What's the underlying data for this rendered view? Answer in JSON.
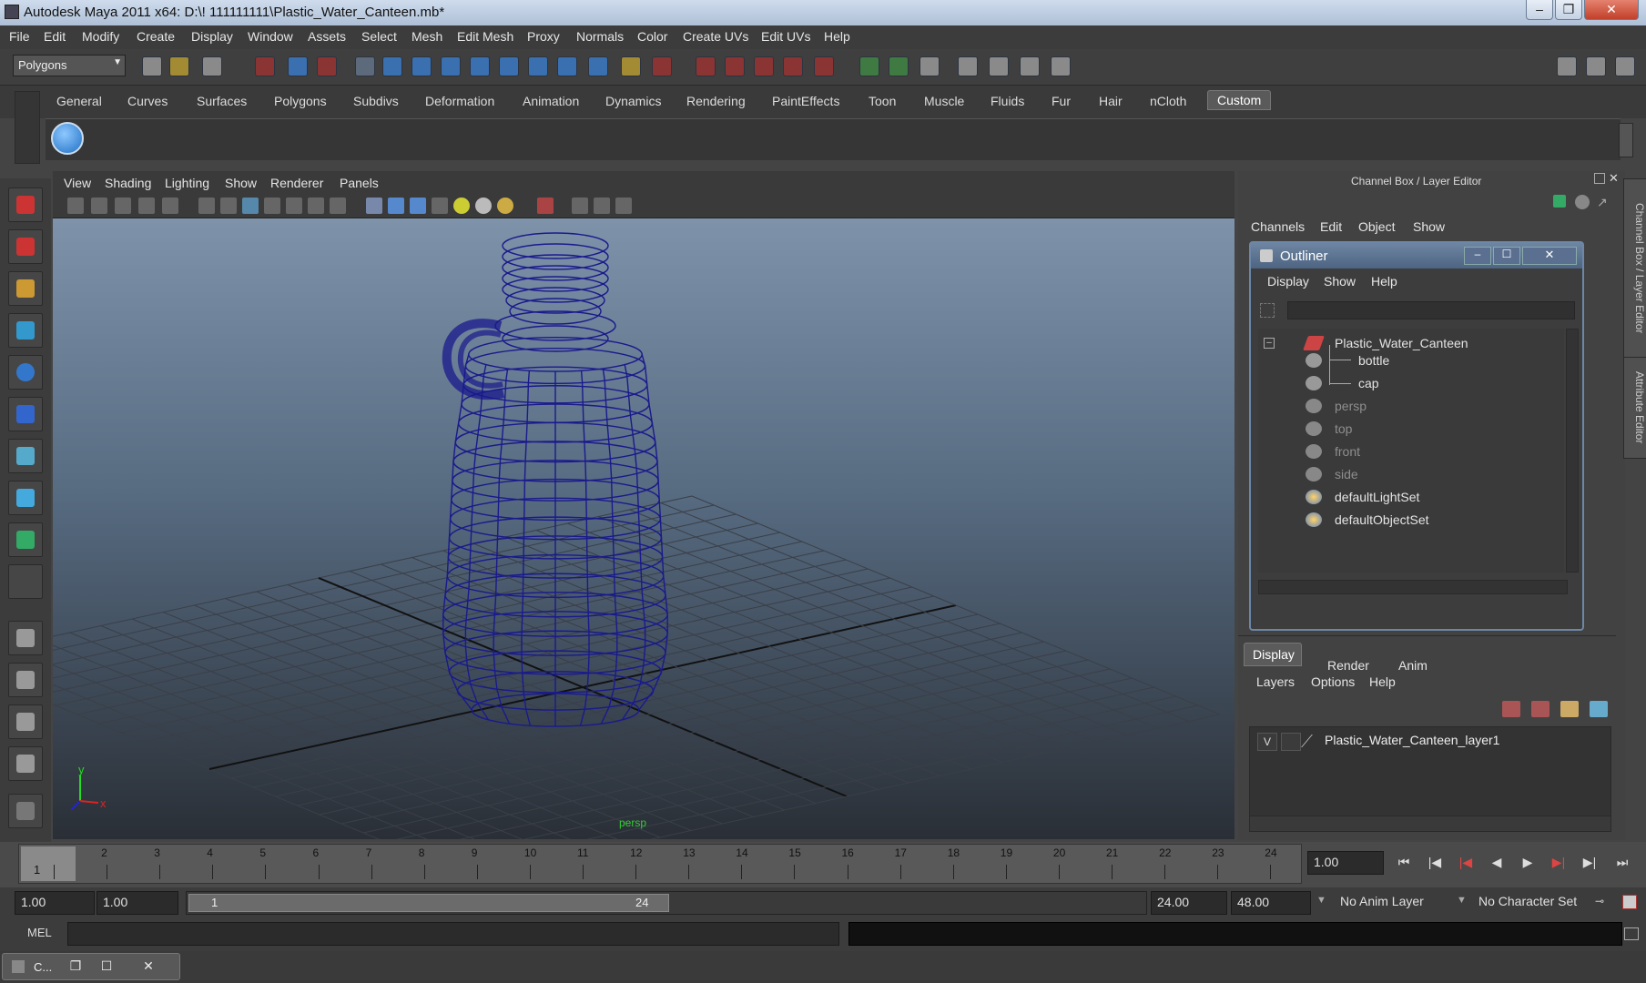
{
  "window": {
    "title": "Autodesk Maya 2011 x64: D:\\! 111111111\\Plastic_Water_Canteen.mb*",
    "controls": [
      "–",
      "❐",
      "✕"
    ]
  },
  "menubar": [
    "File",
    "Edit",
    "Modify",
    "Create",
    "Display",
    "Window",
    "Assets",
    "Select",
    "Mesh",
    "Edit Mesh",
    "Proxy",
    "Normals",
    "Color",
    "Create UVs",
    "Edit UVs",
    "Help"
  ],
  "toolbar": {
    "menuset": "Polygons"
  },
  "shelf": {
    "tabs": [
      "General",
      "Curves",
      "Surfaces",
      "Polygons",
      "Subdivs",
      "Deformation",
      "Animation",
      "Dynamics",
      "Rendering",
      "PaintEffects",
      "Toon",
      "Muscle",
      "Fluids",
      "Fur",
      "Hair",
      "nCloth",
      "Custom"
    ],
    "active": "Custom"
  },
  "viewport": {
    "menu": [
      "View",
      "Shading",
      "Lighting",
      "Show",
      "Renderer",
      "Panels"
    ],
    "camera_label": "persp",
    "wire_color": "#1a1a8c"
  },
  "channel_box": {
    "title": "Channel Box / Layer Editor",
    "menu": [
      "Channels",
      "Edit",
      "Object",
      "Show"
    ],
    "side_tabs": [
      "Channel Box / Layer Editor",
      "Attribute Editor"
    ]
  },
  "outliner": {
    "title": "Outliner",
    "menu": [
      "Display",
      "Show",
      "Help"
    ],
    "items": [
      {
        "label": "Plastic_Water_Canteen",
        "dim": false,
        "icon": "group-icon"
      },
      {
        "label": "bottle",
        "dim": false,
        "icon": "mesh-icon"
      },
      {
        "label": "cap",
        "dim": false,
        "icon": "mesh-icon"
      },
      {
        "label": "persp",
        "dim": true,
        "icon": "camera-icon"
      },
      {
        "label": "top",
        "dim": true,
        "icon": "camera-icon"
      },
      {
        "label": "front",
        "dim": true,
        "icon": "camera-icon"
      },
      {
        "label": "side",
        "dim": true,
        "icon": "camera-icon"
      },
      {
        "label": "defaultLightSet",
        "dim": false,
        "icon": "set-icon"
      },
      {
        "label": "defaultObjectSet",
        "dim": false,
        "icon": "set-icon"
      }
    ]
  },
  "layer_editor": {
    "tabs": [
      "Display",
      "Render",
      "Anim"
    ],
    "active_tab": "Display",
    "menu": [
      "Layers",
      "Options",
      "Help"
    ],
    "layer": {
      "visible": "V",
      "name": "Plastic_Water_Canteen_layer1"
    }
  },
  "timeline": {
    "ticks": [
      "1",
      "2",
      "3",
      "4",
      "5",
      "6",
      "7",
      "8",
      "9",
      "10",
      "11",
      "12",
      "13",
      "14",
      "15",
      "16",
      "17",
      "18",
      "19",
      "20",
      "21",
      "22",
      "23",
      "24"
    ],
    "current_frame": "1",
    "current_time": "1.00"
  },
  "range": {
    "start": "1.00",
    "playback_start": "1.00",
    "slider_start": "1",
    "slider_end": "24",
    "playback_end": "24.00",
    "end": "48.00",
    "anim_layer": "No Anim Layer",
    "character_set": "No Character Set"
  },
  "command_line": {
    "label": "MEL"
  },
  "taskbar": {
    "label": "C..."
  }
}
